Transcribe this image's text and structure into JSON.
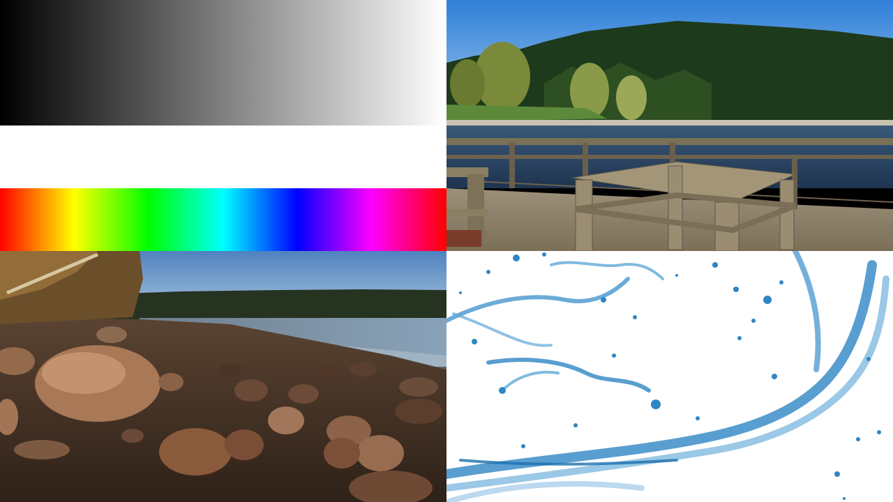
{
  "panels": [
    {
      "name": "test-pattern",
      "bands": [
        "grayscale-ramp",
        "white-band",
        "hue-spectrum"
      ]
    },
    {
      "name": "lakeside-dock-photo"
    },
    {
      "name": "rocky-shore-photo"
    },
    {
      "name": "water-splash-photo"
    }
  ],
  "colors": {
    "sky_blue": "#3f86d6",
    "forest_green": "#1f3d1c",
    "lake_blue": "#2e4a6b",
    "dock_wood": "#8a7a5e",
    "shore_rock": "#6b4a33",
    "splash_blue": "#2f86c4"
  }
}
